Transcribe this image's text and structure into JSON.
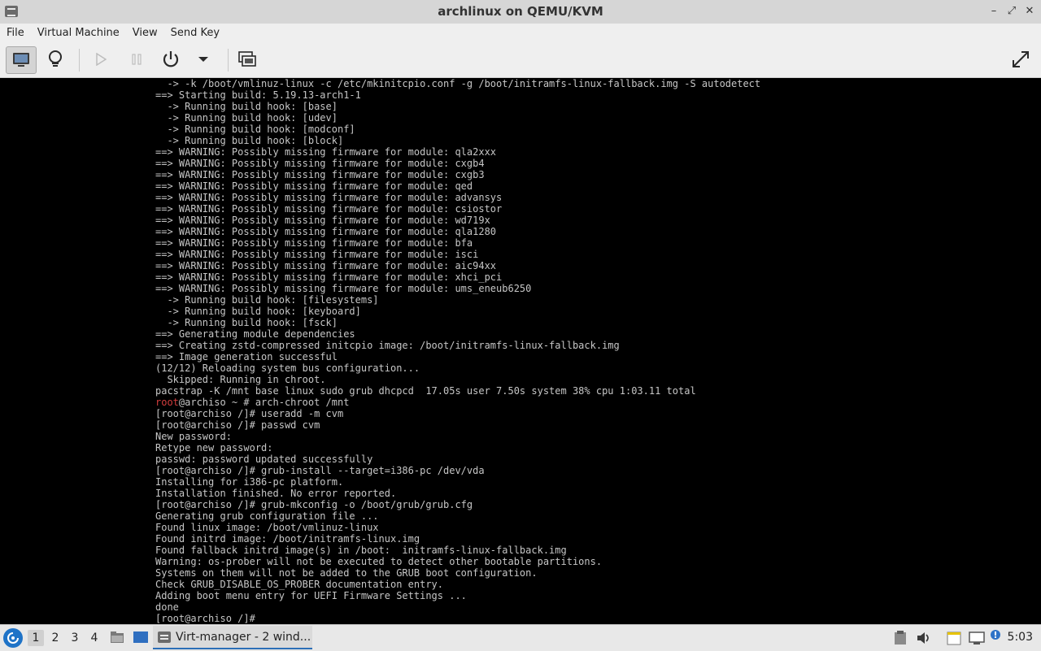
{
  "window": {
    "title": "archlinux on QEMU/KVM",
    "buttons": [
      "–",
      "⤢",
      "✕"
    ]
  },
  "menu": [
    "File",
    "Virtual Machine",
    "View",
    "Send Key"
  ],
  "toolbar": {
    "icons": [
      "console-icon",
      "lightbulb-icon",
      "play-icon",
      "pause-icon",
      "power-icon",
      "dropdown-icon",
      "snapshot-icon",
      "fullscreen-icon"
    ]
  },
  "console": {
    "lines": [
      "  -> -k /boot/vmlinuz-linux -c /etc/mkinitcpio.conf -g /boot/initramfs-linux-fallback.img -S autodetect",
      "==> Starting build: 5.19.13-arch1-1",
      "  -> Running build hook: [base]",
      "  -> Running build hook: [udev]",
      "  -> Running build hook: [modconf]",
      "  -> Running build hook: [block]",
      "==> WARNING: Possibly missing firmware for module: qla2xxx",
      "==> WARNING: Possibly missing firmware for module: cxgb4",
      "==> WARNING: Possibly missing firmware for module: cxgb3",
      "==> WARNING: Possibly missing firmware for module: qed",
      "==> WARNING: Possibly missing firmware for module: advansys",
      "==> WARNING: Possibly missing firmware for module: csiostor",
      "==> WARNING: Possibly missing firmware for module: wd719x",
      "==> WARNING: Possibly missing firmware for module: qla1280",
      "==> WARNING: Possibly missing firmware for module: bfa",
      "==> WARNING: Possibly missing firmware for module: isci",
      "==> WARNING: Possibly missing firmware for module: aic94xx",
      "==> WARNING: Possibly missing firmware for module: xhci_pci",
      "==> WARNING: Possibly missing firmware for module: ums_eneub6250",
      "  -> Running build hook: [filesystems]",
      "  -> Running build hook: [keyboard]",
      "  -> Running build hook: [fsck]",
      "==> Generating module dependencies",
      "==> Creating zstd-compressed initcpio image: /boot/initramfs-linux-fallback.img",
      "==> Image generation successful",
      "(12/12) Reloading system bus configuration...",
      "  Skipped: Running in chroot.",
      "pacstrap -K /mnt base linux sudo grub dhcpcd  17.05s user 7.50s system 38% cpu 1:03.11 total",
      "@ROOT@ # arch-chroot /mnt",
      "[root@archiso /]# useradd -m cvm",
      "[root@archiso /]# passwd cvm",
      "New password:",
      "Retype new password:",
      "passwd: password updated successfully",
      "[root@archiso /]# grub-install --target=i386-pc /dev/vda",
      "Installing for i386-pc platform.",
      "Installation finished. No error reported.",
      "[root@archiso /]# grub-mkconfig -o /boot/grub/grub.cfg",
      "Generating grub configuration file ...",
      "Found linux image: /boot/vmlinuz-linux",
      "Found initrd image: /boot/initramfs-linux.img",
      "Found fallback initrd image(s) in /boot:  initramfs-linux-fallback.img",
      "Warning: os-prober will not be executed to detect other bootable partitions.",
      "Systems on them will not be added to the GRUB boot configuration.",
      "Check GRUB_DISABLE_OS_PROBER documentation entry.",
      "Adding boot menu entry for UEFI Firmware Settings ...",
      "done",
      "[root@archiso /]# "
    ],
    "root_prompt_user": "root",
    "root_prompt_rest": "@archiso ~"
  },
  "taskbar": {
    "desktops": [
      "1",
      "2",
      "3",
      "4"
    ],
    "task_label": "Virt-manager - 2 wind...",
    "clock": "5:03"
  }
}
